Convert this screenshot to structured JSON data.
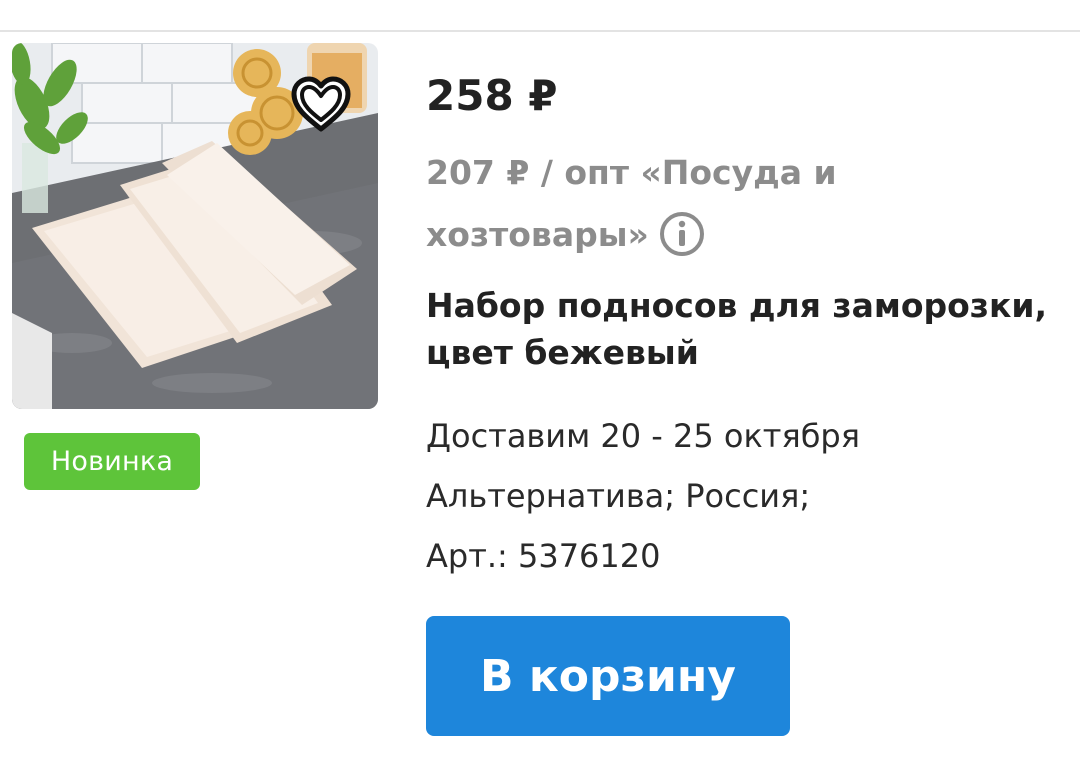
{
  "product": {
    "price": "258 ₽",
    "wholesale_text": "207 ₽ / опт «Посуда и хозтовары»",
    "title": "Набор подносов для заморозки, цвет бежевый",
    "delivery": "Доставим 20 - 25 октября",
    "supplier": "Альтернатива; Россия;",
    "sku": "Арт.: 5376120",
    "badge": "Новинка",
    "cart_button_label": "В корзину"
  },
  "icons": {
    "favorite": "heart-icon",
    "info": "info-icon"
  },
  "colors": {
    "badge_bg": "#5ec43a",
    "button_bg": "#1e86db",
    "muted_text": "#8c8c8c"
  }
}
